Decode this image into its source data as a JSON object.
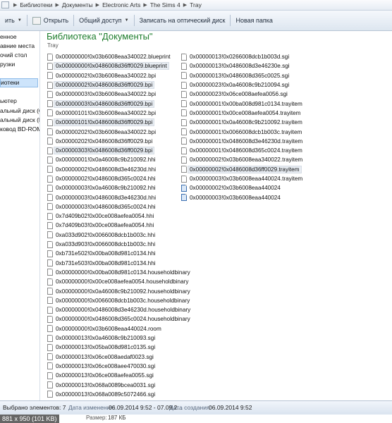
{
  "breadcrumb": {
    "items": [
      "Библиотеки",
      "Документы",
      "Electronic Arts",
      "The Sims 4",
      "Tray"
    ]
  },
  "toolbar": {
    "organize": "ить",
    "open": "Открыть",
    "share": "Общий доступ",
    "burn": "Записать на оптический диск",
    "new_folder": "Новая папка"
  },
  "nav": {
    "items": [
      "енное",
      "авние места",
      "очий стол",
      "рузки",
      "иотеки",
      "ьютер",
      "альный диск (C",
      "альный диск (D",
      "ковод BD-ROM"
    ]
  },
  "library": {
    "title": "Библиотека \"Документы\"",
    "subtitle": "Tray"
  },
  "files_col1": [
    "0x00000000!0x03b6008eaa340022.blueprint",
    "0x00000000!0x0486008d36ff0029.blueprint",
    "0x00000002!0x03b6008eaa340022.bpi",
    "0x00000002!0x0486008d36ff0029.bpi",
    "0x00000003!0x03b6008eaa340022.bpi",
    "0x00000003!0x0486008d36ff0029.bpi",
    "0x00000101!0x03b6008eaa340022.bpi",
    "0x00000101!0x0486008d36ff0029.bpi",
    "0x00000202!0x03b6008eaa340022.bpi",
    "0x00000202!0x0486008d36ff0029.bpi",
    "0x00000303!0x0486008d36ff0029.bpi",
    "0x00000001!0x0a46008c9b210092.hhi",
    "0x00000002!0x0486008d3e46230d.hhi",
    "0x00000002!0x0486008d365c0024.hhi",
    "0x00000003!0x0a46008c9b210092.hhi",
    "0x00000003!0x0486008d3e46230d.hhi",
    "0x00000003!0x0486008d365c0024.hhi",
    "0x7d409b02!0x00ce008aefea0054.hhi",
    "0x7d409b03!0x00ce008aefea0054.hhi",
    "0xa033d902!0x0066008dcb1b003c.hhi",
    "0xa033d903!0x0066008dcb1b003c.hhi",
    "0xb731e502!0x00ba008d981c0134.hhi",
    "0xb731e503!0x00ba008d981c0134.hhi",
    "0x00000000!0x00ba008d981c0134.householdbinary",
    "0x00000000!0x00ce008aefea0054.householdbinary",
    "0x00000000!0x0a46008c9b210092.householdbinary",
    "0x00000000!0x0066008dcb1b003c.householdbinary",
    "0x00000000!0x0486008d3e46230d.householdbinary",
    "0x00000000!0x0486008d365c0024.householdbinary",
    "0x00000000!0x03b6008eaa440024.room",
    "0x00000013!0x0a46008c9b210093.sgi",
    "0x00000013!0x05ba008d981c0135.sgi",
    "0x00000013!0x06ce008aedaf0023.sgi",
    "0x00000013!0x06ce008aee470030.sgi",
    "0x00000013!0x06ce008aefea0055.sgi",
    "0x00000013!0x068a0089bcea0031.sgi",
    "0x00000013!0x068a0089c5072466.sgi"
  ],
  "files_col2": [
    "0x00000013!0x0266008dcb1b003d.sgi",
    "0x00000013!0x0486008d3e46230e.sgi",
    "0x00000013!0x0486008d365c0025.sgi",
    "0x00000023!0x0a46008c9b210094.sgi",
    "0x00000023!0x06ce008aefea0056.sgi",
    "0x00000001!0x00ba008d981c0134.trayitem",
    "0x00000001!0x00ce008aefea0054.trayitem",
    "0x00000001!0x0a46008c9b210092.trayitem",
    "0x00000001!0x0066008dcb1b003c.trayitem",
    "0x00000001!0x0486008d3e46230d.trayitem",
    "0x00000001!0x0486008d365c0024.trayitem",
    "0x00000002!0x03b6008eaa340022.trayitem",
    "0x00000002!0x0486008d36ff0029.trayitem",
    "0x00000003!0x03b6008eaa440024.trayitem",
    "0x00000002!0x03b6008eaa440024",
    "0x00000003!0x03b6008eaa440024"
  ],
  "status": {
    "selected": "Выбрано элементов: 7",
    "modified_label": "Дата изменения:",
    "modified_value": "06.09.2014 9:52 - 07.09.2...",
    "created_label": "Дата создания:",
    "created_value": "06.09.2014 9:52",
    "size_label": "Размер:",
    "size_value": "187 КБ"
  },
  "image_dims": "881 x 950 (101 KB)"
}
